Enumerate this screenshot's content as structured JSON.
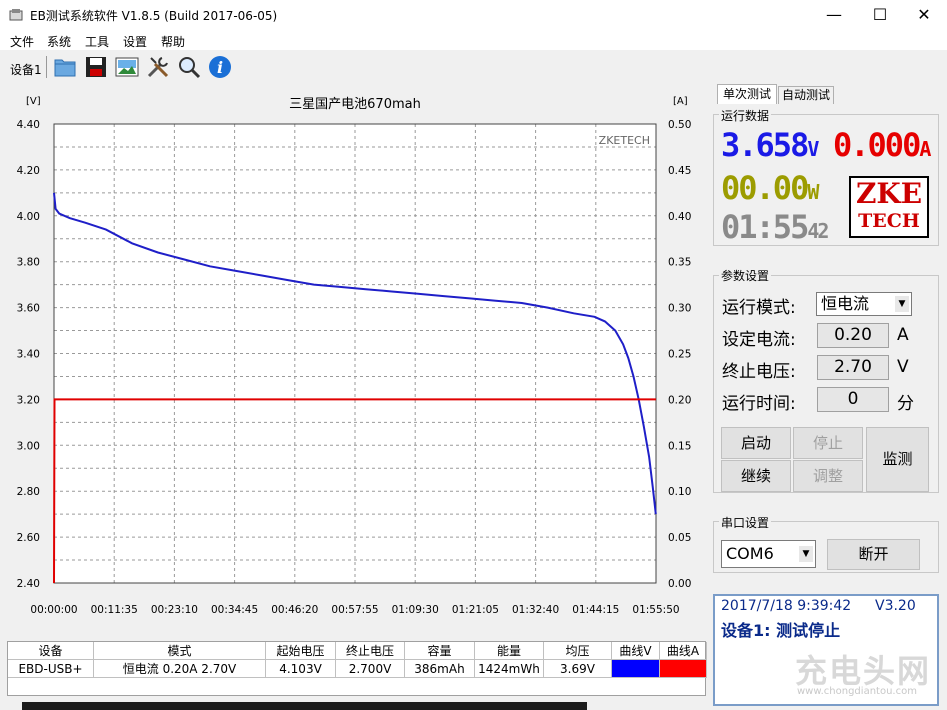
{
  "window": {
    "title": "EB测试系统软件 V1.8.5 (Build 2017-06-05)",
    "minimize": "—",
    "maximize": "☐",
    "close": "✕"
  },
  "menu": [
    "文件",
    "系统",
    "工具",
    "设置",
    "帮助"
  ],
  "toolbar": {
    "device": "设备1",
    "icons": [
      "open-folder-icon",
      "save-disk-icon",
      "picture-icon",
      "tools-icon",
      "magnifier-icon",
      "info-icon"
    ]
  },
  "chart_data": {
    "type": "line",
    "title": "三星国产电池670mah",
    "watermark": "ZKETECH",
    "left_unit": "[V]",
    "right_unit": "[A]",
    "ylim_left": [
      2.4,
      4.4
    ],
    "ylim_right": [
      0.0,
      0.5
    ],
    "y_ticks_left": [
      "4.40",
      "4.20",
      "4.00",
      "3.80",
      "3.60",
      "3.40",
      "3.20",
      "3.00",
      "2.80",
      "2.60",
      "2.40"
    ],
    "y_ticks_right": [
      "0.50",
      "0.45",
      "0.40",
      "0.35",
      "0.30",
      "0.25",
      "0.20",
      "0.15",
      "0.10",
      "0.05",
      "0.00"
    ],
    "x_ticks": [
      "00:00:00",
      "00:11:35",
      "00:23:10",
      "00:34:45",
      "00:46:20",
      "00:57:55",
      "01:09:30",
      "01:21:05",
      "01:32:40",
      "01:44:15",
      "01:55:50"
    ],
    "xlim_minutes": [
      0,
      115.83
    ],
    "grid": true,
    "series": [
      {
        "color": "#1f1fc8",
        "axis": "left",
        "x_minutes": [
          0,
          0.3,
          1,
          3,
          6,
          10,
          15,
          20,
          25,
          30,
          35,
          40,
          45,
          50,
          55,
          60,
          65,
          70,
          75,
          80,
          85,
          90,
          95,
          100,
          104,
          106,
          108,
          109.5,
          110.5,
          111.5,
          112.5,
          113.5,
          114.5,
          115.2,
          115.8
        ],
        "values": [
          4.1,
          4.03,
          4.01,
          3.99,
          3.97,
          3.94,
          3.88,
          3.84,
          3.81,
          3.78,
          3.76,
          3.74,
          3.72,
          3.7,
          3.69,
          3.68,
          3.67,
          3.66,
          3.65,
          3.64,
          3.63,
          3.62,
          3.6,
          3.575,
          3.56,
          3.54,
          3.5,
          3.44,
          3.38,
          3.3,
          3.2,
          3.08,
          2.95,
          2.82,
          2.7
        ]
      },
      {
        "color": "#e00000",
        "axis": "right",
        "x_minutes": [
          0,
          0.1,
          115.83
        ],
        "values": [
          0.0,
          0.2,
          0.2
        ]
      }
    ]
  },
  "tabs": [
    "单次测试",
    "自动测试"
  ],
  "run_data": {
    "title": "运行数据",
    "voltage": "3.658",
    "voltage_unit": "V",
    "current": "0.000",
    "current_unit": "A",
    "power": "00.00",
    "power_unit": "W",
    "time_hm": "01:55",
    "time_s": "42",
    "logo_line1": "ZKE",
    "logo_line2": "TECH",
    "color_voltage": "#1a1ae6",
    "color_current": "#e60000",
    "color_power": "#9c9c00"
  },
  "params": {
    "title": "参数设置",
    "mode_label": "运行模式:",
    "mode_value": "恒电流",
    "current_label": "设定电流:",
    "current_value": "0.20",
    "current_unit": "A",
    "cutoff_label": "终止电压:",
    "cutoff_value": "2.70",
    "cutoff_unit": "V",
    "time_label": "运行时间:",
    "time_value": "0",
    "time_unit": "分"
  },
  "buttons": {
    "start": "启动",
    "stop": "停止",
    "continue": "继续",
    "adjust": "调整",
    "monitor": "监测"
  },
  "serial": {
    "title": "串口设置",
    "port": "COM6",
    "disconnect": "断开"
  },
  "status": {
    "datetime": "2017/7/18  9:39:42",
    "version": "V3.20",
    "message": "设备1: 测试停止"
  },
  "table": {
    "headers": [
      "设备",
      "模式",
      "起始电压",
      "终止电压",
      "容量",
      "能量",
      "均压",
      "曲线V",
      "曲线A"
    ],
    "row": [
      "EBD-USB+",
      "恒电流  0.20A  2.70V",
      "4.103V",
      "2.700V",
      "386mAh",
      "1424mWh",
      "3.69V",
      "",
      ""
    ],
    "curve_v_color": "#0000ff",
    "curve_a_color": "#ff0000"
  },
  "watermark": {
    "text": "充电头网",
    "url": "www.chongdiantou.com"
  }
}
